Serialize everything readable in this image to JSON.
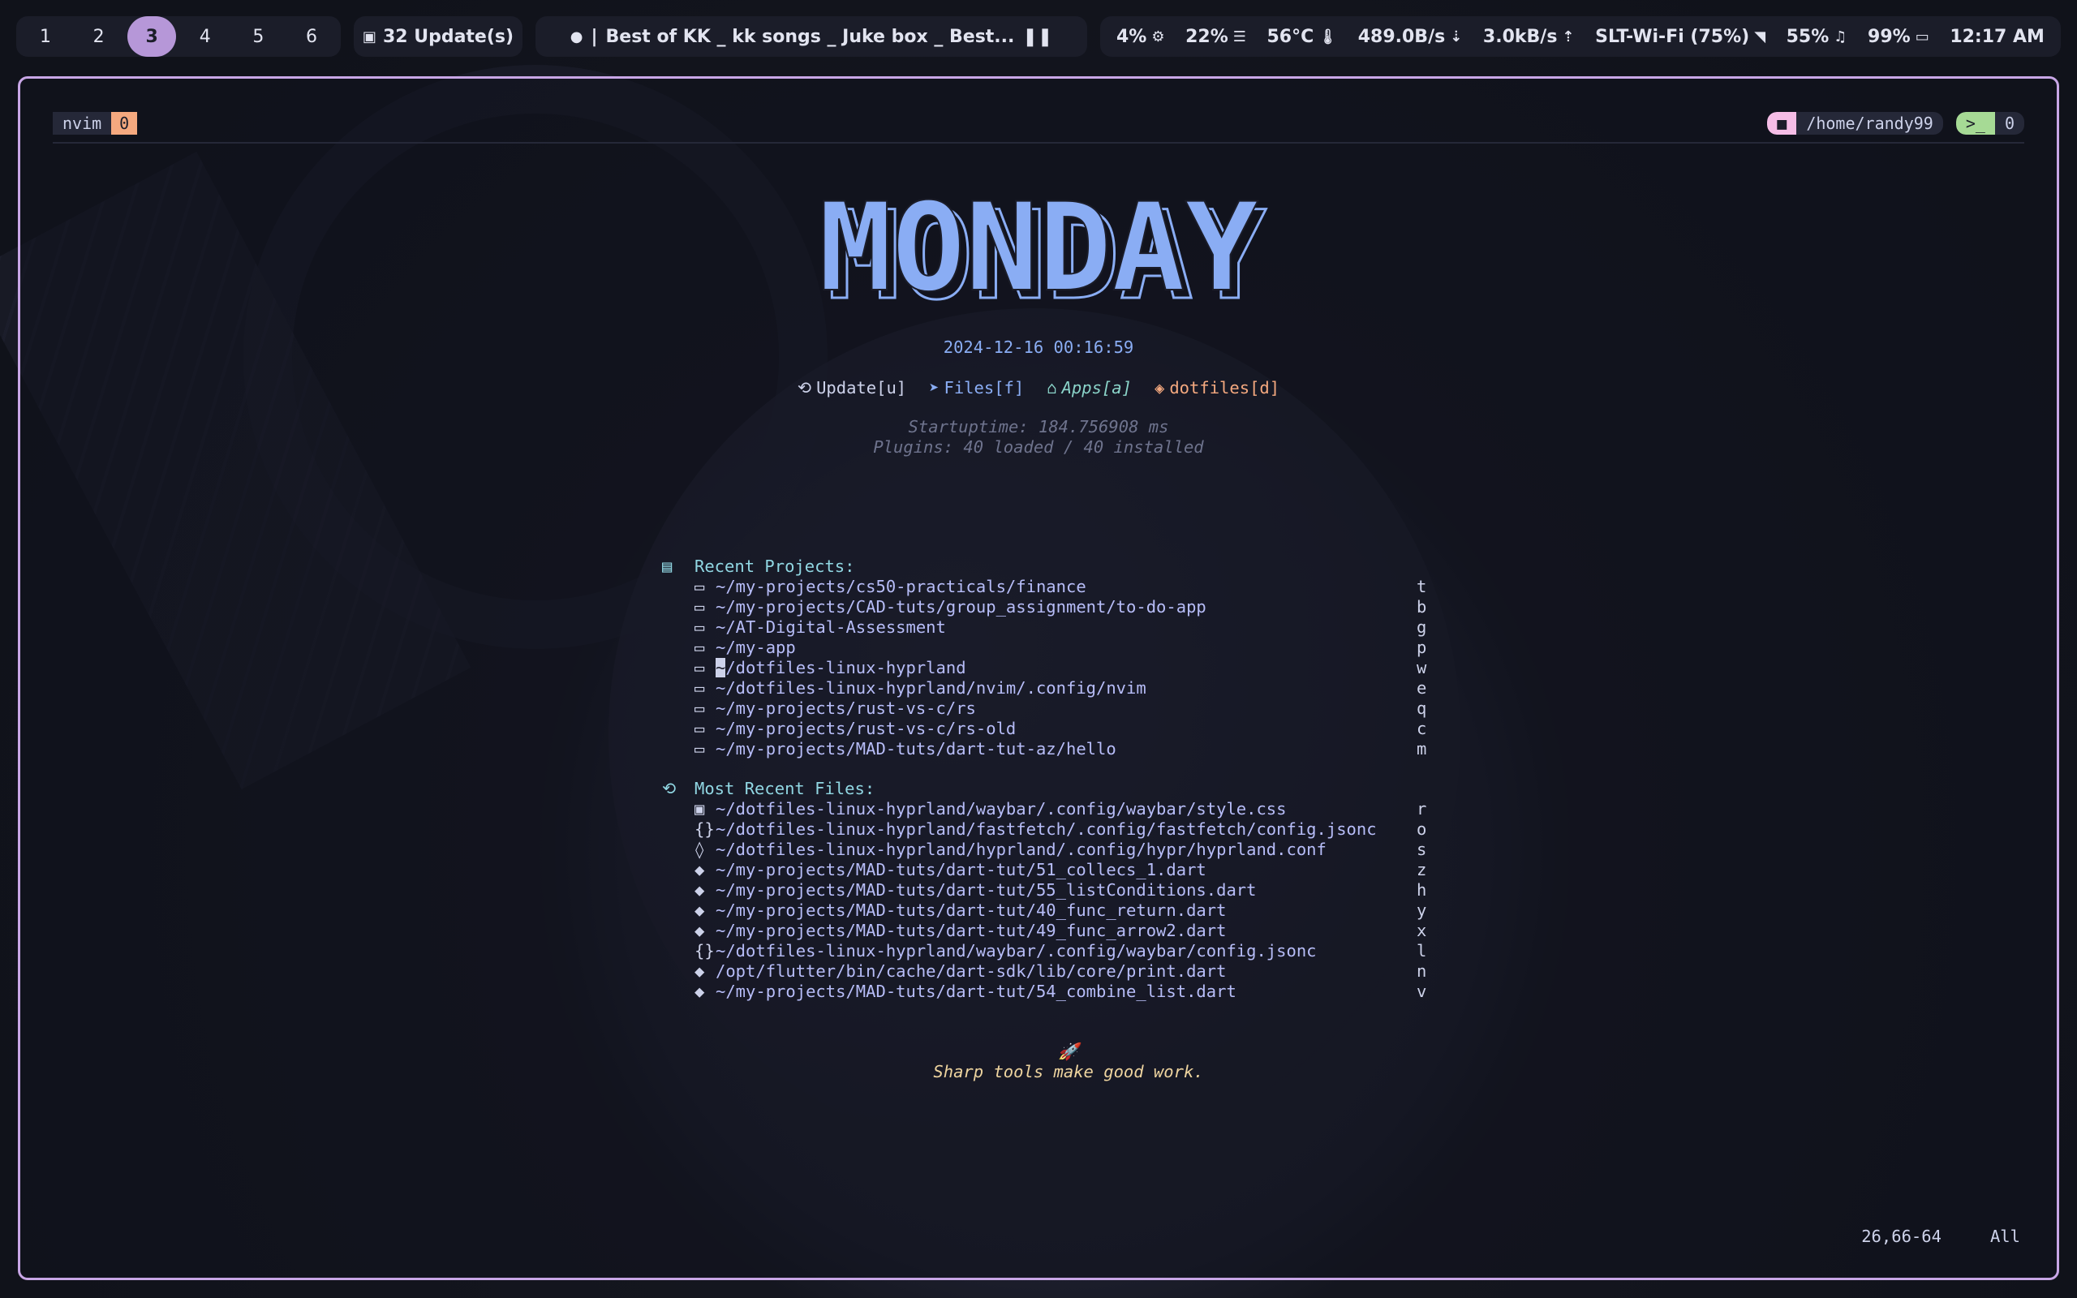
{
  "topbar": {
    "workspaces": [
      "1",
      "2",
      "3",
      "4",
      "5",
      "6"
    ],
    "active_workspace": "3",
    "updates": "32 Update(s)",
    "media": {
      "separator": "|",
      "title": "Best of KK _ kk songs _ Juke box _ Best..."
    },
    "stats": {
      "cpu": "4%",
      "memory": "22%",
      "temperature": "56°C",
      "net_down": "489.0B/s",
      "net_up": "3.0kB/s",
      "wifi": "SLT-Wi-Fi (75%)",
      "volume": "55%",
      "battery": "99%",
      "clock": "12:17 AM"
    }
  },
  "tmux": {
    "session": "nvim",
    "window_index": "0",
    "cwd": "/home/randy99",
    "pane_count": "0"
  },
  "dashboard": {
    "header_art": "MONDAY",
    "datetime": "2024-12-16 00:16:59",
    "actions": [
      {
        "label": "Update[u]",
        "icon": "update-icon"
      },
      {
        "label": "Files[f]",
        "icon": "send-icon"
      },
      {
        "label": "Apps[a]",
        "icon": "home-icon"
      },
      {
        "label": "dotfiles[d]",
        "icon": "package-icon"
      }
    ],
    "startup": "Startuptime: 184.756908 ms",
    "plugins": "Plugins: 40 loaded / 40 installed",
    "recent_projects": {
      "title": "Recent Projects:",
      "items": [
        {
          "path": "~/my-projects/cs50-practicals/finance",
          "key": "t"
        },
        {
          "path": "~/my-projects/CAD-tuts/group_assignment/to-do-app",
          "key": "b"
        },
        {
          "path": "~/AT-Digital-Assessment",
          "key": "g"
        },
        {
          "path": "~/my-app",
          "key": "p"
        },
        {
          "path": "~/dotfiles-linux-hyprland",
          "key": "w"
        },
        {
          "path": "~/dotfiles-linux-hyprland/nvim/.config/nvim",
          "key": "e"
        },
        {
          "path": "~/my-projects/rust-vs-c/rs",
          "key": "q"
        },
        {
          "path": "~/my-projects/rust-vs-c/rs-old",
          "key": "c"
        },
        {
          "path": "~/my-projects/MAD-tuts/dart-tut-az/hello",
          "key": "m"
        }
      ]
    },
    "recent_files": {
      "title": "Most Recent Files:",
      "items": [
        {
          "path": "~/dotfiles-linux-hyprland/waybar/.config/waybar/style.css",
          "key": "r",
          "icon": "css-icon"
        },
        {
          "path": "~/dotfiles-linux-hyprland/fastfetch/.config/fastfetch/config.jsonc",
          "key": "o",
          "icon": "json-icon"
        },
        {
          "path": "~/dotfiles-linux-hyprland/hyprland/.config/hypr/hyprland.conf",
          "key": "s",
          "icon": "hyprland-icon"
        },
        {
          "path": "~/my-projects/MAD-tuts/dart-tut/51_collecs_1.dart",
          "key": "z",
          "icon": "dart-icon"
        },
        {
          "path": "~/my-projects/MAD-tuts/dart-tut/55_listConditions.dart",
          "key": "h",
          "icon": "dart-icon"
        },
        {
          "path": "~/my-projects/MAD-tuts/dart-tut/40_func_return.dart",
          "key": "y",
          "icon": "dart-icon"
        },
        {
          "path": "~/my-projects/MAD-tuts/dart-tut/49_func_arrow2.dart",
          "key": "x",
          "icon": "dart-icon"
        },
        {
          "path": "~/dotfiles-linux-hyprland/waybar/.config/waybar/config.jsonc",
          "key": "l",
          "icon": "json-icon"
        },
        {
          "path": "/opt/flutter/bin/cache/dart-sdk/lib/core/print.dart",
          "key": "n",
          "icon": "dart-icon"
        },
        {
          "path": "~/my-projects/MAD-tuts/dart-tut/54_combine_list.dart",
          "key": "v",
          "icon": "dart-icon"
        }
      ]
    },
    "footer": "Sharp tools make good work."
  },
  "statusline": {
    "position": "26,66-64",
    "scroll": "All"
  },
  "colors": {
    "accent": "#b697d8",
    "border": "#c8a6e6",
    "header": "#8aadf4",
    "quote": "#eed49f"
  }
}
